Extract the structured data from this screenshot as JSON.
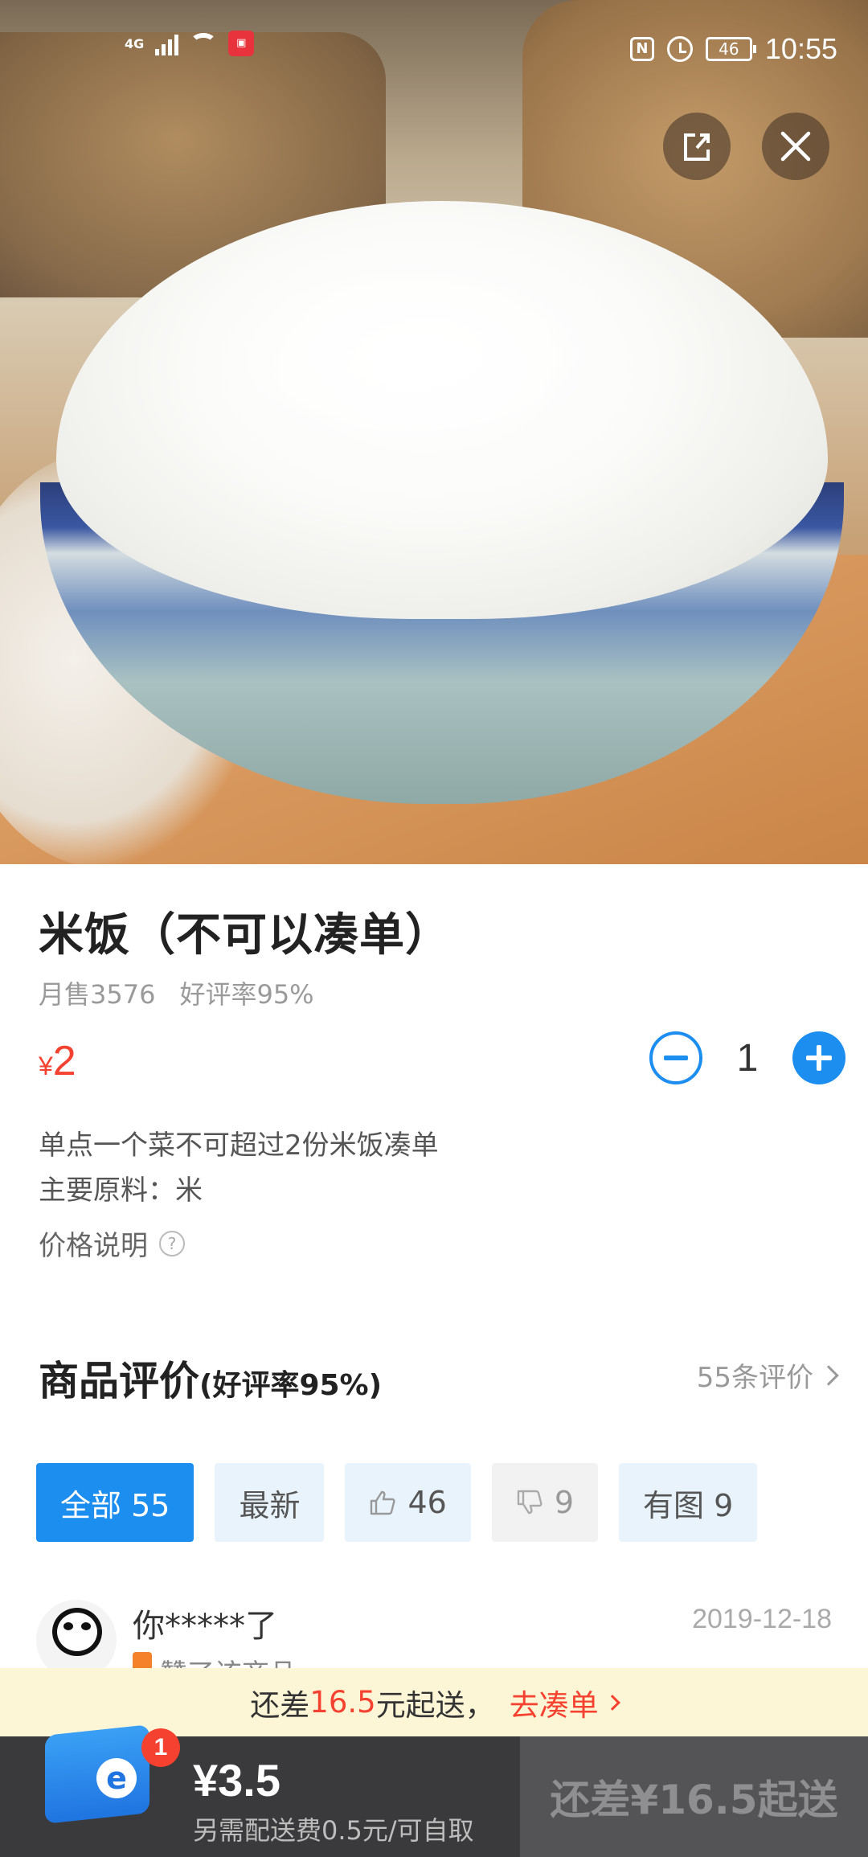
{
  "status_bar": {
    "network": "4G",
    "time": "10:55",
    "battery": "46",
    "app_badge": "VMALL"
  },
  "product": {
    "image_icon": "rice-bowl-photo",
    "title": "米饭（不可以凑单）",
    "monthly_sales": "月售3576",
    "positive_rate": "好评率95%",
    "currency": "¥",
    "price": "2",
    "quantity": "1",
    "description": "单点一个菜不可超过2份米饭凑单",
    "ingredients": "主要原料：米",
    "price_note": "价格说明",
    "help_glyph": "?"
  },
  "reviews": {
    "title": "商品评价",
    "subtitle": "(好评率95%)",
    "more_link": "55条评价",
    "filters": [
      {
        "label": "全部 55"
      },
      {
        "label": "最新"
      },
      {
        "label": "46"
      },
      {
        "label": "9"
      },
      {
        "label": "有图 9"
      }
    ],
    "first": {
      "name": "你*****了",
      "date": "2019-12-18",
      "text": "赞了该商品"
    }
  },
  "notice": {
    "prefix": "还差",
    "amount": "16.5",
    "suffix": "元起送，",
    "action": "去凑单"
  },
  "cart": {
    "badge": "1",
    "total": "¥3.5",
    "fee_note": "另需配送费0.5元/可自取",
    "checkout_label": "还差¥16.5起送"
  },
  "colors": {
    "accent": "#1c8ef0",
    "price": "#f5412f",
    "notice_bg": "#fdf6d6",
    "cart_bg": "#3a3a3c"
  }
}
